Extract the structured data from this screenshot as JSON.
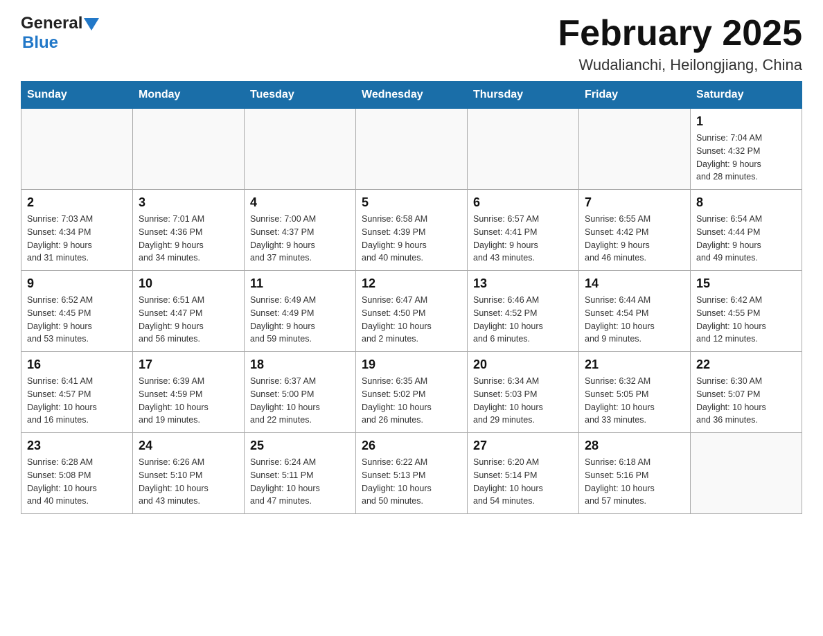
{
  "header": {
    "logo": {
      "text_general": "General",
      "text_blue": "Blue",
      "triangle": "▲"
    },
    "title": "February 2025",
    "subtitle": "Wudalianchi, Heilongjiang, China"
  },
  "calendar": {
    "days_of_week": [
      "Sunday",
      "Monday",
      "Tuesday",
      "Wednesday",
      "Thursday",
      "Friday",
      "Saturday"
    ],
    "weeks": [
      {
        "cells": [
          {
            "day": "",
            "info": ""
          },
          {
            "day": "",
            "info": ""
          },
          {
            "day": "",
            "info": ""
          },
          {
            "day": "",
            "info": ""
          },
          {
            "day": "",
            "info": ""
          },
          {
            "day": "",
            "info": ""
          },
          {
            "day": "1",
            "info": "Sunrise: 7:04 AM\nSunset: 4:32 PM\nDaylight: 9 hours\nand 28 minutes."
          }
        ]
      },
      {
        "cells": [
          {
            "day": "2",
            "info": "Sunrise: 7:03 AM\nSunset: 4:34 PM\nDaylight: 9 hours\nand 31 minutes."
          },
          {
            "day": "3",
            "info": "Sunrise: 7:01 AM\nSunset: 4:36 PM\nDaylight: 9 hours\nand 34 minutes."
          },
          {
            "day": "4",
            "info": "Sunrise: 7:00 AM\nSunset: 4:37 PM\nDaylight: 9 hours\nand 37 minutes."
          },
          {
            "day": "5",
            "info": "Sunrise: 6:58 AM\nSunset: 4:39 PM\nDaylight: 9 hours\nand 40 minutes."
          },
          {
            "day": "6",
            "info": "Sunrise: 6:57 AM\nSunset: 4:41 PM\nDaylight: 9 hours\nand 43 minutes."
          },
          {
            "day": "7",
            "info": "Sunrise: 6:55 AM\nSunset: 4:42 PM\nDaylight: 9 hours\nand 46 minutes."
          },
          {
            "day": "8",
            "info": "Sunrise: 6:54 AM\nSunset: 4:44 PM\nDaylight: 9 hours\nand 49 minutes."
          }
        ]
      },
      {
        "cells": [
          {
            "day": "9",
            "info": "Sunrise: 6:52 AM\nSunset: 4:45 PM\nDaylight: 9 hours\nand 53 minutes."
          },
          {
            "day": "10",
            "info": "Sunrise: 6:51 AM\nSunset: 4:47 PM\nDaylight: 9 hours\nand 56 minutes."
          },
          {
            "day": "11",
            "info": "Sunrise: 6:49 AM\nSunset: 4:49 PM\nDaylight: 9 hours\nand 59 minutes."
          },
          {
            "day": "12",
            "info": "Sunrise: 6:47 AM\nSunset: 4:50 PM\nDaylight: 10 hours\nand 2 minutes."
          },
          {
            "day": "13",
            "info": "Sunrise: 6:46 AM\nSunset: 4:52 PM\nDaylight: 10 hours\nand 6 minutes."
          },
          {
            "day": "14",
            "info": "Sunrise: 6:44 AM\nSunset: 4:54 PM\nDaylight: 10 hours\nand 9 minutes."
          },
          {
            "day": "15",
            "info": "Sunrise: 6:42 AM\nSunset: 4:55 PM\nDaylight: 10 hours\nand 12 minutes."
          }
        ]
      },
      {
        "cells": [
          {
            "day": "16",
            "info": "Sunrise: 6:41 AM\nSunset: 4:57 PM\nDaylight: 10 hours\nand 16 minutes."
          },
          {
            "day": "17",
            "info": "Sunrise: 6:39 AM\nSunset: 4:59 PM\nDaylight: 10 hours\nand 19 minutes."
          },
          {
            "day": "18",
            "info": "Sunrise: 6:37 AM\nSunset: 5:00 PM\nDaylight: 10 hours\nand 22 minutes."
          },
          {
            "day": "19",
            "info": "Sunrise: 6:35 AM\nSunset: 5:02 PM\nDaylight: 10 hours\nand 26 minutes."
          },
          {
            "day": "20",
            "info": "Sunrise: 6:34 AM\nSunset: 5:03 PM\nDaylight: 10 hours\nand 29 minutes."
          },
          {
            "day": "21",
            "info": "Sunrise: 6:32 AM\nSunset: 5:05 PM\nDaylight: 10 hours\nand 33 minutes."
          },
          {
            "day": "22",
            "info": "Sunrise: 6:30 AM\nSunset: 5:07 PM\nDaylight: 10 hours\nand 36 minutes."
          }
        ]
      },
      {
        "cells": [
          {
            "day": "23",
            "info": "Sunrise: 6:28 AM\nSunset: 5:08 PM\nDaylight: 10 hours\nand 40 minutes."
          },
          {
            "day": "24",
            "info": "Sunrise: 6:26 AM\nSunset: 5:10 PM\nDaylight: 10 hours\nand 43 minutes."
          },
          {
            "day": "25",
            "info": "Sunrise: 6:24 AM\nSunset: 5:11 PM\nDaylight: 10 hours\nand 47 minutes."
          },
          {
            "day": "26",
            "info": "Sunrise: 6:22 AM\nSunset: 5:13 PM\nDaylight: 10 hours\nand 50 minutes."
          },
          {
            "day": "27",
            "info": "Sunrise: 6:20 AM\nSunset: 5:14 PM\nDaylight: 10 hours\nand 54 minutes."
          },
          {
            "day": "28",
            "info": "Sunrise: 6:18 AM\nSunset: 5:16 PM\nDaylight: 10 hours\nand 57 minutes."
          },
          {
            "day": "",
            "info": ""
          }
        ]
      }
    ]
  }
}
